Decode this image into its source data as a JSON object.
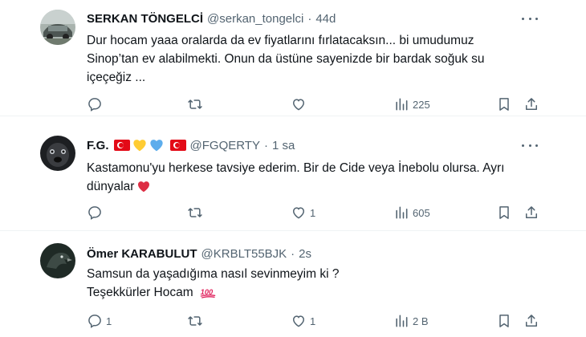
{
  "tweets": [
    {
      "name": "SERKAN TÖNGELCİ",
      "handle": "@serkan_tongelci",
      "dot": "·",
      "time": "44d",
      "lines": [
        "Dur hocam yaaa oralarda da ev fiyatlarını fırlatacaksın... bi umudumuz",
        "Sinop’tan ev alabilmekti. Onun da üstüne sayenizde bir bardak soğuk su",
        "içeçeğiz ..."
      ],
      "replies": "",
      "retweets": "",
      "likes": "",
      "views": "225",
      "avatar": "car-photo"
    },
    {
      "name": "F.G.",
      "handle": "@FGQERTY",
      "dot": "·",
      "time": "1 sa",
      "lines": [
        "Kastamonu'yu herkese tavsiye ederim. Bir de Cide veya İnebolu olursa. Ayrı",
        "dünyalar"
      ],
      "replies": "",
      "retweets": "",
      "likes": "1",
      "views": "605",
      "avatar": "dog-photo",
      "name_emojis": [
        "turkey-flag",
        "yellow-heart",
        "blue-heart",
        "turkey-flag"
      ]
    },
    {
      "name": "Ömer KARABULUT",
      "handle": "@KRBLT55BJK",
      "dot": "·",
      "time": "2s",
      "lines": [
        "Samsun da yaşadığıma nasıl sevinmeyim ki ?",
        "Teşekkürler Hocam"
      ],
      "replies": "1",
      "retweets": "",
      "likes": "1",
      "views": "2 B",
      "avatar": "eagle-photo"
    }
  ],
  "colors": {
    "text": "#0f1419",
    "secondary": "#536471",
    "divider": "#eff3f4",
    "flag_red": "#e30a17",
    "heart_red": "#e0245e"
  }
}
